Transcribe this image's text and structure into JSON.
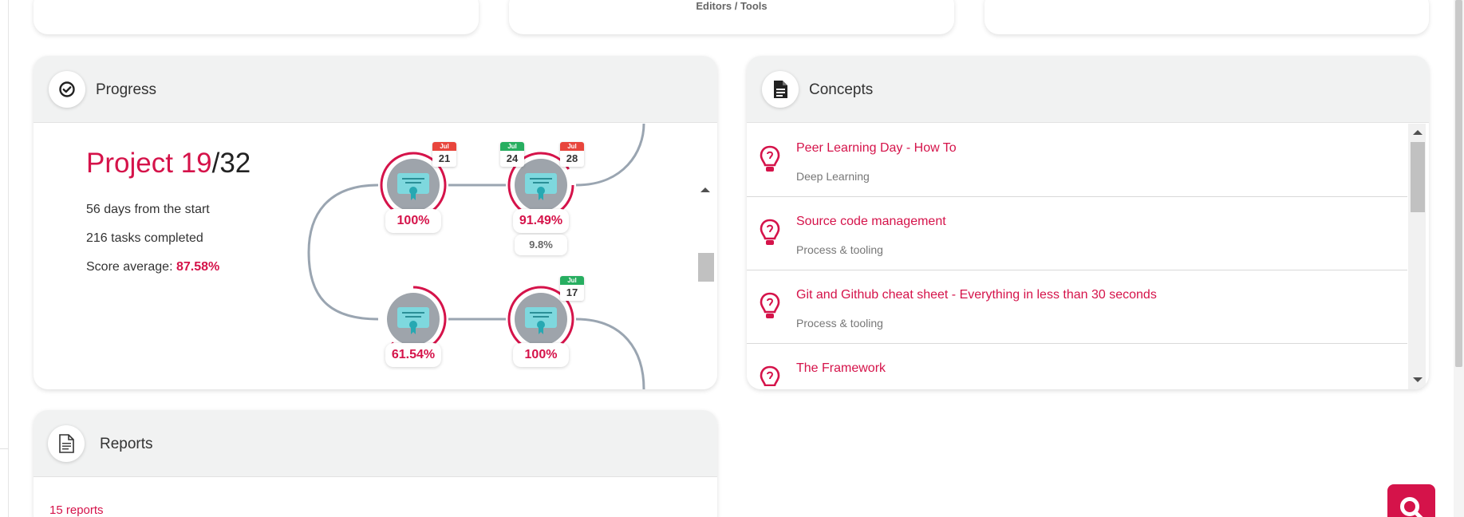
{
  "top_cards": {
    "middle_breadcrumb": "Editors / Tools"
  },
  "progress": {
    "title": "Progress",
    "project_label": "Project",
    "project_current": "19",
    "project_total": "/32",
    "days_from_start": "56 days from the start",
    "tasks_completed": "216 tasks completed",
    "score_label": "Score average: ",
    "score_value": "87.58%",
    "nodes": [
      {
        "percent": "100%",
        "calendar": {
          "month": "Jul",
          "day": "21",
          "color": "#e8453c"
        }
      },
      {
        "percent": "91.49%",
        "subtext": "9.8%",
        "calendars": [
          {
            "month": "Jul",
            "day": "24",
            "color": "#27ae60"
          },
          {
            "month": "Jul",
            "day": "28",
            "color": "#e8453c"
          }
        ]
      },
      {
        "percent": "61.54%"
      },
      {
        "percent": "100%",
        "calendar": {
          "month": "Jul",
          "day": "17",
          "color": "#27ae60"
        }
      }
    ]
  },
  "concepts": {
    "title": "Concepts",
    "items": [
      {
        "title": "Peer Learning Day - How To",
        "category": "Deep Learning"
      },
      {
        "title": "Source code management",
        "category": "Process & tooling"
      },
      {
        "title": "Git and Github cheat sheet - Everything in less than 30 seconds",
        "category": "Process & tooling"
      },
      {
        "title": "The Framework",
        "category": ""
      }
    ]
  },
  "reports": {
    "title": "Reports",
    "count": "15 reports"
  },
  "colors": {
    "accent": "#d5134a",
    "header_bg": "#f1f2f2",
    "track": "#9aa5b1"
  },
  "icons": {
    "progress": "check-circle-icon",
    "concepts": "document-icon",
    "reports": "report-icon",
    "concept_item": "lightbulb-icon",
    "fab": "search-icon"
  }
}
